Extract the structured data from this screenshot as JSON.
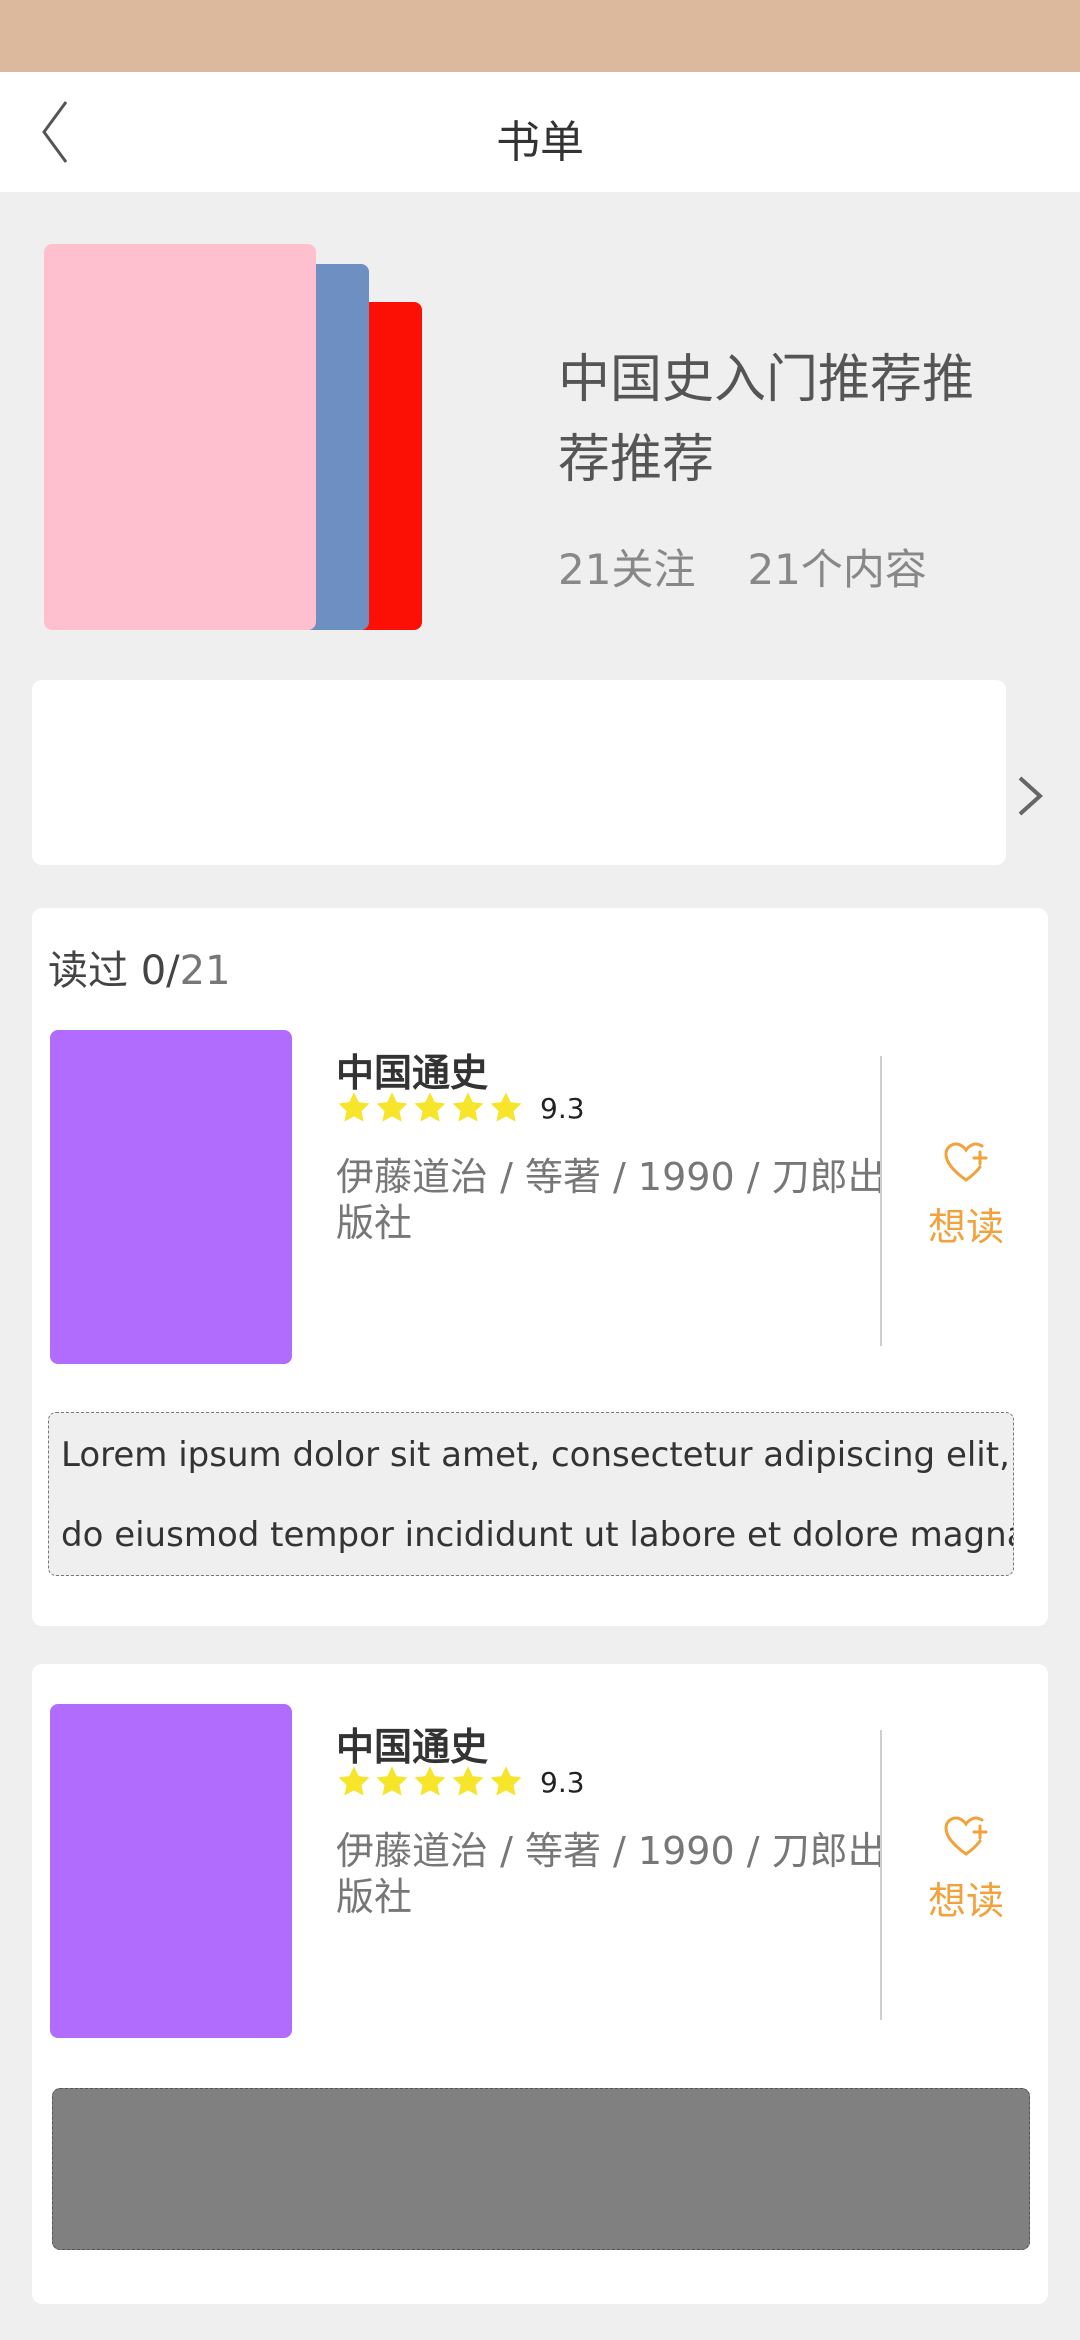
{
  "nav": {
    "title": "书单"
  },
  "booklist": {
    "title": "中国史入门推荐推荐推荐",
    "followers": "21关注",
    "items": "21个内容",
    "cover_colors": [
      "#fec0cf",
      "#6d8fc2",
      "#fc0f05"
    ]
  },
  "progress": {
    "label": "读过 0/",
    "total": "21"
  },
  "books": [
    {
      "title": "中国通史",
      "stars": 5,
      "rating": "9.3",
      "meta": "伊藤道治 / 等著 / 1990 / 刀郎出版社",
      "want_label": "想读",
      "excerpt": [
        "Lorem ipsum dolor sit amet, consectetur adipiscing elit, sed",
        "do eiusmod tempor incididunt ut labore et dolore magna"
      ]
    },
    {
      "title": "中国通史",
      "stars": 5,
      "rating": "9.3",
      "meta": "伊藤道治 / 等著 / 1990 / 刀郎出版社",
      "want_label": "想读"
    }
  ],
  "colors": {
    "status_bar": "#dcb89c",
    "book_cover": "#b26cfd",
    "star": "#f6e52a",
    "accent": "#f2a23c"
  },
  "icons": [
    "back-chevron-icon",
    "chevron-right-icon",
    "star-icon",
    "heart-plus-icon"
  ]
}
